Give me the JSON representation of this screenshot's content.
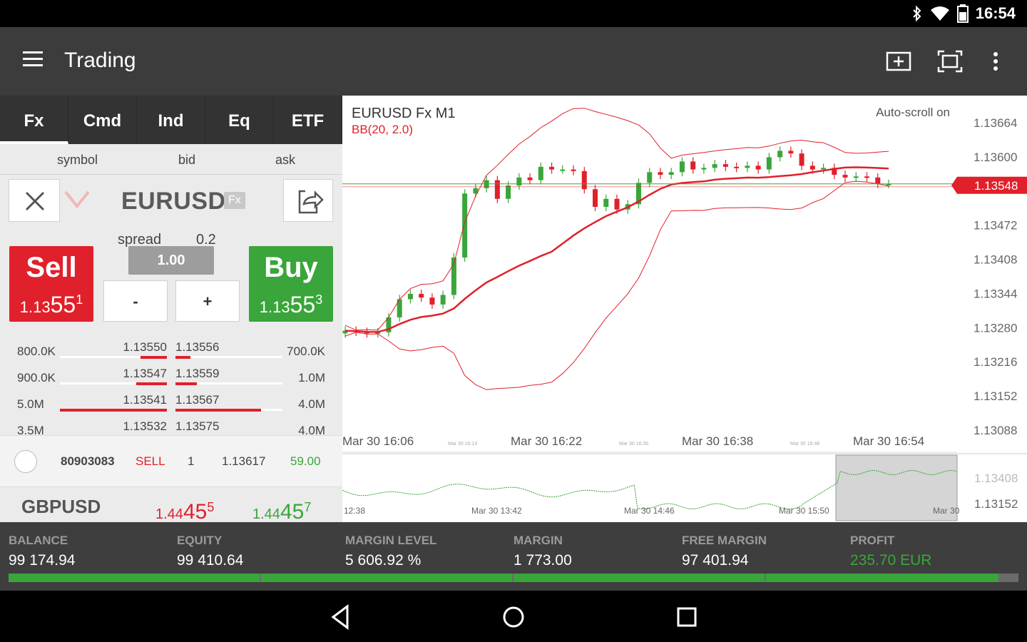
{
  "status": {
    "time": "16:54"
  },
  "app": {
    "title": "Trading"
  },
  "tabs": [
    "Fx",
    "Cmd",
    "Ind",
    "Eq",
    "ETF"
  ],
  "columns": {
    "symbol": "symbol",
    "bid": "bid",
    "ask": "ask"
  },
  "instrument": {
    "name": "EURUSD",
    "badge": "Fx",
    "spread_label": "spread",
    "spread_value": "0.2",
    "volume": "1.00",
    "minus": "-",
    "plus": "+",
    "sell": {
      "label": "Sell",
      "price_small": "1.13",
      "price_big": "55",
      "price_sup": "1"
    },
    "buy": {
      "label": "Buy",
      "price_small": "1.13",
      "price_big": "55",
      "price_sup": "3"
    }
  },
  "depth": [
    {
      "bid_vol": "800.0K",
      "bid": "1.13550",
      "ask": "1.13556",
      "ask_vol": "700.0K",
      "bid_fill": 0.25,
      "ask_fill": 0.14
    },
    {
      "bid_vol": "900.0K",
      "bid": "1.13547",
      "ask": "1.13559",
      "ask_vol": "1.0M",
      "bid_fill": 0.29,
      "ask_fill": 0.2
    },
    {
      "bid_vol": "5.0M",
      "bid": "1.13541",
      "ask": "1.13567",
      "ask_vol": "4.0M",
      "bid_fill": 1.0,
      "ask_fill": 0.8
    },
    {
      "bid_vol": "3.5M",
      "bid": "1.13532",
      "ask": "1.13575",
      "ask_vol": "4.0M",
      "bid_fill": 0.7,
      "ask_fill": 0.8
    }
  ],
  "position": {
    "id": "80903083",
    "side": "SELL",
    "volume": "1",
    "open_price": "1.13617",
    "profit": "59.00"
  },
  "next_instrument": {
    "name": "GBPUSD",
    "bid_small": "1.44",
    "bid_big": "45",
    "bid_sup": "5",
    "ask_small": "1.44",
    "ask_big": "45",
    "ask_sup": "7"
  },
  "chart": {
    "title": "EURUSD Fx M1",
    "indicator": "BB(20, 2.0)",
    "autoscroll": "Auto-scroll on",
    "current_price": "1.13548",
    "y_ticks": [
      "1.13664",
      "1.13600",
      "1.13472",
      "1.13408",
      "1.13344",
      "1.13280",
      "1.13216",
      "1.13152",
      "1.13088"
    ],
    "x_ticks": [
      "Mar 30 16:06",
      "Mar 30 16:22",
      "Mar 30 16:38",
      "Mar 30 16:54"
    ],
    "x_minor_ticks": [
      "Mar 30 16:14",
      "Mar 30 16:30",
      "Mar 30 16:46"
    ],
    "navigator": {
      "y_ticks": [
        "1.13408",
        "1.13152"
      ],
      "x_ticks": [
        "12:38",
        "Mar 30 13:42",
        "Mar 30 14:46",
        "Mar 30 15:50",
        "Mar 30"
      ]
    },
    "colors": {
      "up": "#3aa53a",
      "down": "#e0202a",
      "band": "#e0202a"
    }
  },
  "summary": {
    "balance": {
      "label": "BALANCE",
      "value": "99 174.94"
    },
    "equity": {
      "label": "EQUITY",
      "value": "99 410.64"
    },
    "margin_level": {
      "label": "MARGIN LEVEL",
      "value": "5 606.92 %"
    },
    "margin": {
      "label": "MARGIN",
      "value": "1 773.00"
    },
    "free_margin": {
      "label": "FREE MARGIN",
      "value": "97 401.94"
    },
    "profit": {
      "label": "PROFIT",
      "value": "235.70 EUR",
      "color": "#3aa53a"
    },
    "margin_fill": 0.98
  }
}
